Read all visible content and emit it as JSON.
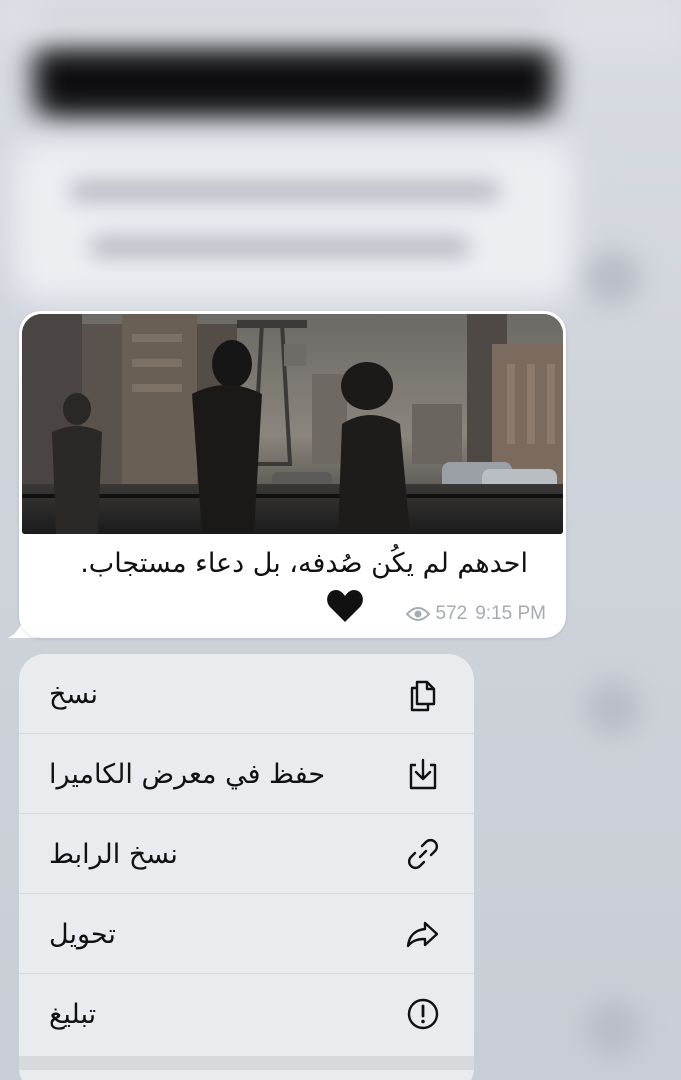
{
  "message": {
    "caption": "احدهم لم يكُن صُدفه، بل دعاء مستجاب.",
    "emoji": "black-heart",
    "views": "572",
    "time": "9:15 PM"
  },
  "menu": {
    "items": [
      {
        "label": "نسخ",
        "icon": "copy-icon"
      },
      {
        "label": "حفظ في معرض الكاميرا",
        "icon": "save-to-camera-roll-icon"
      },
      {
        "label": "نسخ الرابط",
        "icon": "link-icon"
      },
      {
        "label": "تحويل",
        "icon": "forward-icon"
      },
      {
        "label": "تبليغ",
        "icon": "report-icon"
      }
    ]
  },
  "colors": {
    "bubble": "#ffffff",
    "menu_bg": "#eaebee",
    "meta_text": "#a6abb1",
    "text": "#111111"
  }
}
